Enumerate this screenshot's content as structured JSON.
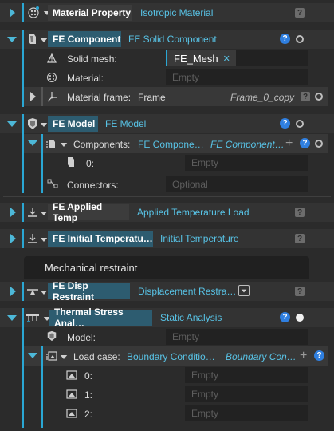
{
  "material_property": {
    "name": "Material Property",
    "type": "Isotropic Material",
    "help": "?"
  },
  "fe_component": {
    "name": "FE Component",
    "type": "FE Solid Component",
    "help": "?",
    "solid_mesh_label": "Solid mesh:",
    "solid_mesh_value": "FE_Mesh",
    "remove_glyph": "✕",
    "material_label": "Material:",
    "material_placeholder": "Empty",
    "material_frame_label": "Material frame:",
    "material_frame_value": "Frame",
    "material_frame_link": "Frame_0_copy",
    "frame_help": "?"
  },
  "fe_model": {
    "name": "FE Model",
    "type": "FE Model",
    "help": "?",
    "components_label": "Components:",
    "components_type": "FE Compone…",
    "components_link": "FE Component…",
    "components_help": "?",
    "item0_label": "0:",
    "item0_placeholder": "Empty",
    "connectors_label": "Connectors:",
    "connectors_placeholder": "Optional"
  },
  "fe_applied_temp": {
    "name": "FE Applied Temp",
    "type": "Applied Temperature Load",
    "help": "?"
  },
  "fe_initial_temp": {
    "name": "FE Initial Temperatu…",
    "type": "Initial Temperature",
    "help": "?"
  },
  "section_title": "Mechanical restraint",
  "fe_disp_restraint": {
    "name": "FE Disp Restraint",
    "type": "Displacement Restra…",
    "help": "?"
  },
  "thermal_stress": {
    "name": "Thermal Stress Anal…",
    "type": "Static Analysis",
    "help": "?",
    "model_label": "Model:",
    "model_placeholder": "Empty",
    "load_case_label": "Load case:",
    "load_case_type": "Boundary Conditio…",
    "load_case_link": "Boundary Con…",
    "load_case_help": "?",
    "items": [
      {
        "label": "0:",
        "placeholder": "Empty"
      },
      {
        "label": "1:",
        "placeholder": "Empty"
      },
      {
        "label": "2:",
        "placeholder": "Empty"
      }
    ]
  },
  "plus_glyph": "+",
  "colors": {
    "accent": "#2aa7d4",
    "link": "#58c3e6",
    "badge_blue": "#2f7fe0",
    "bg": "#2b2b2b"
  }
}
